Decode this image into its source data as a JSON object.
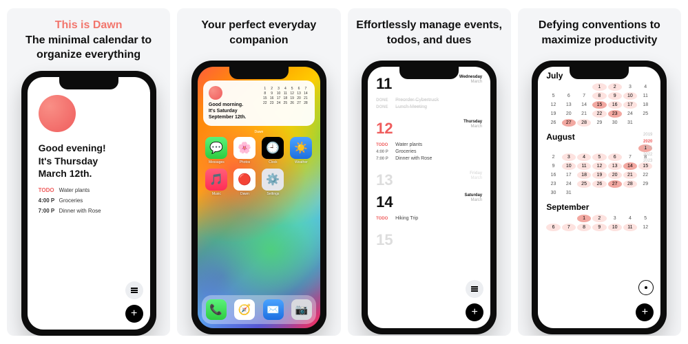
{
  "panels": [
    {
      "title_accent": "This is Dawn",
      "subtitle": "The minimal calendar to organize everything"
    },
    {
      "title": "Your perfect everyday companion"
    },
    {
      "title": "Effortlessly manage events, todos, and dues"
    },
    {
      "title": "Defying conventions to maximize productivity"
    }
  ],
  "colors": {
    "accent": "#f2766d"
  },
  "screen1": {
    "greeting_l1": "Good evening!",
    "greeting_l2": "It's Thursday",
    "greeting_l3": "March 12th.",
    "items": [
      {
        "time": "TODO",
        "label": "Water plants",
        "red": true
      },
      {
        "time": "4:00 P",
        "label": "Groceries",
        "red": false
      },
      {
        "time": "7:00 P",
        "label": "Dinner with Rose",
        "red": false
      }
    ]
  },
  "screen2": {
    "widget": {
      "l1": "Good morning.",
      "l2": "It's Saturday",
      "l3": "September 12th."
    },
    "widget_label": "Dawn",
    "apps": [
      {
        "name": "Messages",
        "bg": "linear-gradient(#5af27a,#2ecc40)",
        "glyph": "💬"
      },
      {
        "name": "Photos",
        "bg": "#fff",
        "glyph": "🌸"
      },
      {
        "name": "Clock",
        "bg": "#000",
        "glyph": "🕘"
      },
      {
        "name": "Weather",
        "bg": "linear-gradient(#4aa3ff,#1e6fe0)",
        "glyph": "☀️"
      },
      {
        "name": "Music",
        "bg": "linear-gradient(#ff5e7a,#ff2d55)",
        "glyph": "🎵"
      },
      {
        "name": "Dawn",
        "bg": "#fff",
        "glyph": "🔴"
      },
      {
        "name": "Settings",
        "bg": "#e5e5ea",
        "glyph": "⚙️"
      }
    ],
    "dock": [
      {
        "name": "Phone",
        "bg": "linear-gradient(#5af27a,#2ecc40)",
        "glyph": "📞"
      },
      {
        "name": "Safari",
        "bg": "#fff",
        "glyph": "🧭"
      },
      {
        "name": "Mail",
        "bg": "linear-gradient(#4aa3ff,#1e6fe0)",
        "glyph": "✉️"
      },
      {
        "name": "Camera",
        "bg": "#d9d9de",
        "glyph": "📷"
      }
    ]
  },
  "screen3": {
    "days": [
      {
        "num": "11",
        "weekday": "Wednesday",
        "month": "March",
        "today": false,
        "muted": false,
        "items": [
          {
            "tag": "DONE",
            "cls": "done",
            "label": "Preorder Cybertruck"
          },
          {
            "tag": "DONE",
            "cls": "done",
            "label": "Lunch Meeting"
          }
        ]
      },
      {
        "num": "12",
        "weekday": "Thursday",
        "month": "March",
        "today": true,
        "muted": false,
        "items": [
          {
            "tag": "TODO",
            "cls": "todo",
            "label": "Water plants"
          },
          {
            "tag": "4:00 P",
            "cls": "time",
            "label": "Groceries"
          },
          {
            "tag": "7:00 P",
            "cls": "time",
            "label": "Dinner with Rose"
          }
        ]
      },
      {
        "num": "13",
        "weekday": "Friday",
        "month": "March",
        "today": false,
        "muted": true,
        "items": []
      },
      {
        "num": "14",
        "weekday": "Saturday",
        "month": "March",
        "today": false,
        "muted": false,
        "items": [
          {
            "tag": "TODO",
            "cls": "todo",
            "label": "Hiking Trip"
          }
        ]
      },
      {
        "num": "15",
        "weekday": "",
        "month": "",
        "today": false,
        "muted": true,
        "items": []
      }
    ]
  },
  "screen4": {
    "year_labels": [
      "2019",
      "2020",
      "2021",
      "2022",
      "2023"
    ],
    "current_year": "2020",
    "months": [
      {
        "name": "July",
        "lead": 3,
        "days": 31,
        "highlights": {
          "1": 1,
          "2": 1,
          "8": 1,
          "9": 1,
          "10": 1,
          "15": 2,
          "16": 1,
          "17": 1,
          "22": 1,
          "23": 2,
          "27": 2,
          "28": 1
        }
      },
      {
        "name": "August",
        "lead": 6,
        "days": 31,
        "highlights": {
          "1": 2,
          "3": 1,
          "4": 1,
          "5": 1,
          "6": 1,
          "10": 1,
          "11": 1,
          "12": 1,
          "13": 1,
          "14": 2,
          "15": 1,
          "18": 1,
          "19": 1,
          "20": 1,
          "21": 1,
          "25": 1,
          "26": 1,
          "27": 2,
          "28": 1
        }
      },
      {
        "name": "September",
        "lead": 2,
        "days": 12,
        "highlights": {
          "1": 2,
          "2": 1,
          "6": 1,
          "7": 1,
          "8": 1,
          "9": 1,
          "10": 1,
          "11": 1
        }
      }
    ]
  }
}
